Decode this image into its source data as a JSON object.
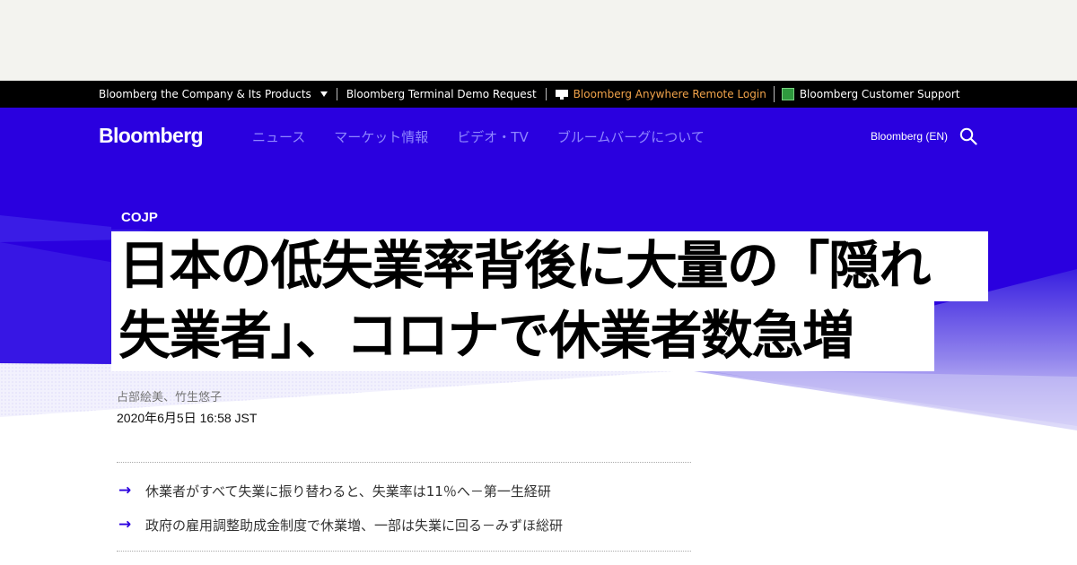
{
  "utility_bar": {
    "company_menu": "Bloomberg the Company & Its Products",
    "demo_request": "Bloomberg Terminal Demo Request",
    "remote_login": "Bloomberg Anywhere Remote Login",
    "customer_support": "Bloomberg Customer Support"
  },
  "header": {
    "brand": "Bloomberg",
    "nav": [
      "ニュース",
      "マーケット情報",
      "ビデオ・TV",
      "ブルームバーグについて"
    ],
    "region": "Bloomberg (EN)"
  },
  "article": {
    "kicker": "COJP",
    "headline_line1": "日本の低失業率背後に大量の「隠れ",
    "headline_line2": "失業者」、コロナで休業者数急増",
    "authors": "占部絵美、竹生悠子",
    "published": "2020年6月5日 16:58 JST",
    "summary": [
      "休業者がすべて失業に振り替わると、失業率は11％へ－第一生経研",
      "政府の雇用調整助成金制度で休業増、一部は失業に回る－みずほ総研"
    ]
  },
  "colors": {
    "hero_blue": "#2a00df",
    "nav_link": "#8f86ff",
    "remote_login": "#f1a34a",
    "support_icon": "#2f9a3e"
  }
}
